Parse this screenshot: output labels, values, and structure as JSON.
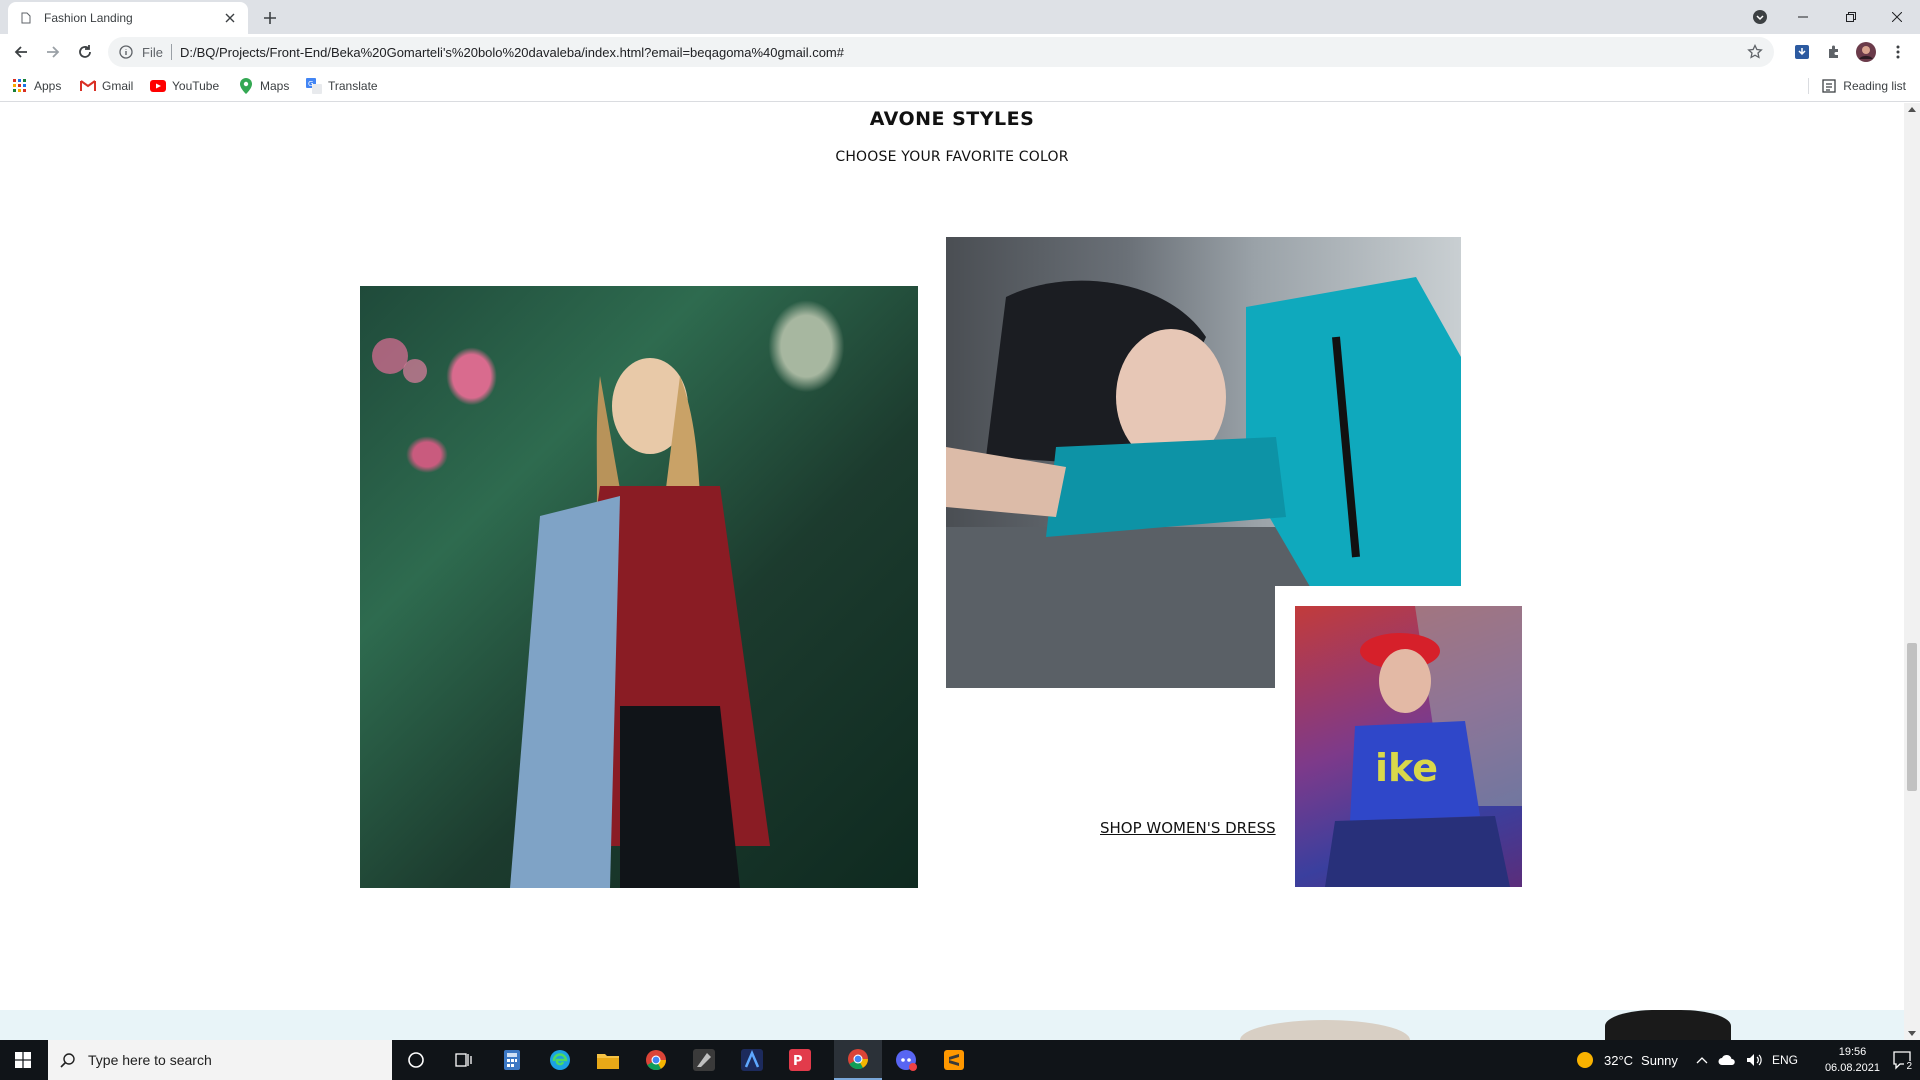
{
  "browser": {
    "tab": {
      "title": "Fashion Landing"
    },
    "address": {
      "scheme_label": "File",
      "url": "D:/BQ/Projects/Front-End/Beka%20Gomarteli's%20bolo%20davaleba/index.html?email=beqagoma%40gmail.com#"
    },
    "bookmarks": [
      {
        "label": "Apps",
        "icon": "apps-grid-icon"
      },
      {
        "label": "Gmail",
        "icon": "gmail-icon"
      },
      {
        "label": "YouTube",
        "icon": "youtube-icon"
      },
      {
        "label": "Maps",
        "icon": "maps-icon"
      },
      {
        "label": "Translate",
        "icon": "translate-icon"
      }
    ],
    "reading_list_label": "Reading list"
  },
  "page": {
    "section_title": "AVONE STYLES",
    "section_subtitle": "CHOOSE YOUR FAVORITE COLOR",
    "shop_link": "SHOP WOMEN'S DRESS",
    "images": [
      {
        "name": "woman-denim-jacket-photo"
      },
      {
        "name": "woman-teal-top-photo"
      },
      {
        "name": "woman-red-cap-photo"
      }
    ]
  },
  "taskbar": {
    "search_placeholder": "Type here to search",
    "weather": {
      "temp": "32°C",
      "condition": "Sunny"
    },
    "language": "ENG",
    "time": "19:56",
    "date": "06.08.2021",
    "notification_count": "2"
  },
  "colors": {
    "accent": "#1a73e8",
    "tabstrip": "#dee1e6",
    "taskbar": "#101418"
  }
}
